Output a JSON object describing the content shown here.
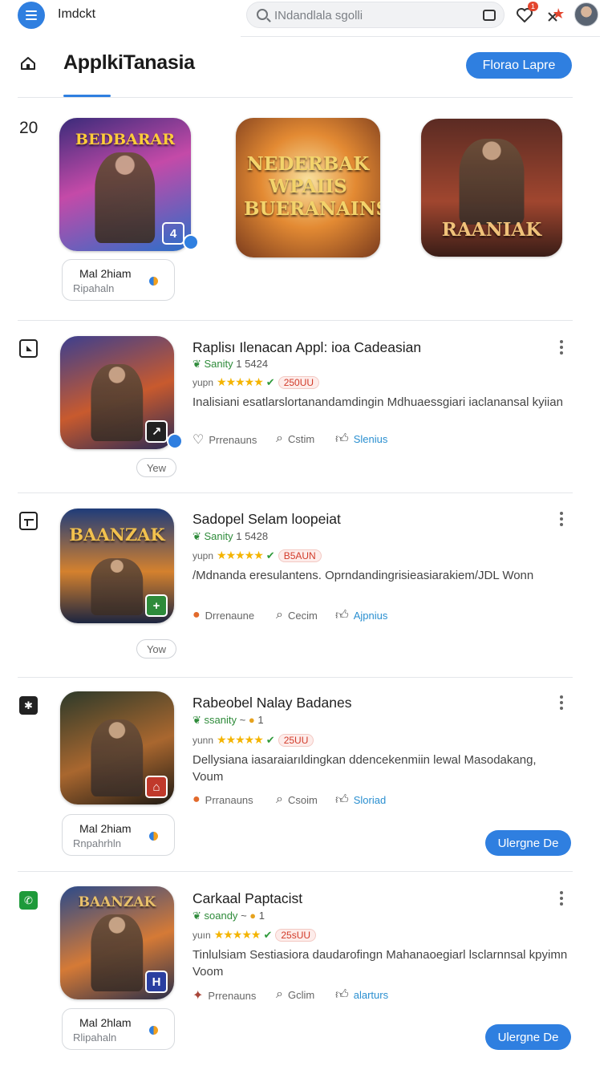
{
  "topbar": {
    "app_name": "Imdckt",
    "search_placeholder": "INdandlala sgolli",
    "notification_count": "1",
    "menu_icon": "hamburger-menu-icon",
    "camera_icon": "camera-icon",
    "heart_icon": "heart-icon",
    "close_icon": "close-icon"
  },
  "header": {
    "title": "ApplkiTanasia",
    "action_label": "Florao Lapre"
  },
  "featured": {
    "count": "20",
    "tiles": [
      {
        "art_text": "BEDBARAR",
        "corner": "4"
      },
      {
        "art_text": "NEDERBAK WPAIIS BUERANAINS",
        "corner": ""
      },
      {
        "art_text": "RAANIAK",
        "corner": ""
      }
    ],
    "card": {
      "title": "Mal 2hiam",
      "subtitle": "Ripahaln"
    }
  },
  "apps": [
    {
      "title": "Raplisı Ilenacan Appl: ioa Cadeasian",
      "meta_label": "Sanity",
      "meta_value": "1 5424",
      "rating_prefix": "yupn",
      "stars": "★★★★★",
      "pill": "250UU",
      "description": "Inalisiani esatlarslortanandamdingin Mdhuaessgiari iaclanansal kyiian",
      "act1": "Prrenauns",
      "act2": "Cstim",
      "act3": "Slenius",
      "view_label": "Yew",
      "art_text": "",
      "corner": "↗"
    },
    {
      "title": "Sadopel Selam loopeiat",
      "meta_label": "Sanity",
      "meta_value": "1 5428",
      "rating_prefix": "yupn",
      "stars": "★★★★★",
      "pill": "B5AUN",
      "description": "/Mdnanda eresulantens.  Oprndandingrisieasiarakiem/JDL Wonn",
      "act1": "Drrenaune",
      "act2": "Cecim",
      "act3": "Ajpnius",
      "view_label": "Yow",
      "art_text": "BAANZAK",
      "corner": "+"
    },
    {
      "title": "Rabeobel Nalay Badanes",
      "meta_label": "ssanity",
      "meta_value": "1",
      "rating_prefix": "yunn",
      "stars": "★★★★★",
      "pill": "25UU",
      "description": "Dellysiana iasaraiarıldingkan ddencekenmiin lewal Masodakang, Voum",
      "act1": "Prranauns",
      "act2": "Csoim",
      "act3": "Sloriad",
      "card_title": "Mal 2hiam",
      "card_subtitle": "Rnpahrhln",
      "install_label": "Ulergne De",
      "art_text": "",
      "corner": "⌂"
    },
    {
      "title": "Carkaal Paptacist",
      "meta_label": "soandy",
      "meta_value": "1",
      "rating_prefix": "yuın",
      "stars": "★★★★★",
      "pill": "25sUU",
      "description": "Tinlulsiam Sestiasiora daudarofingn Mahanaoegiarl lsclarnnsal kpyimn Voom",
      "act1": "Prrenauns",
      "act2": "Gclim",
      "act3": "alarturs",
      "card_title": "Mal 2hlam",
      "card_subtitle": "Rlipahaln",
      "install_label": "Ulergne De",
      "art_text": "BAANZAK",
      "corner": "H"
    }
  ],
  "colors": {
    "accent": "#2f7fe0",
    "star": "#f4b400",
    "pill_text": "#d23b2a",
    "green": "#2e8b3a"
  }
}
